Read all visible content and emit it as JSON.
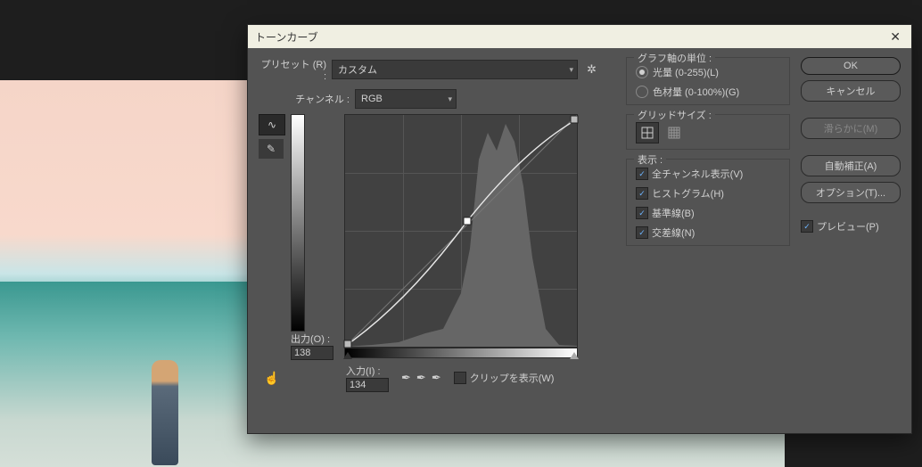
{
  "dialog_title": "トーンカーブ",
  "preset_label": "プリセット (R) :",
  "preset_value": "カスタム",
  "channel_label": "チャンネル :",
  "channel_value": "RGB",
  "output_label": "出力(O) :",
  "output_value": "138",
  "input_label": "入力(I) :",
  "input_value": "134",
  "clip_label": "クリップを表示(W)",
  "axis": {
    "group_title": "グラフ軸の単位 :",
    "light_label": "光量 (0-255)(L)",
    "pigment_label": "色材量 (0-100%)(G)",
    "light_selected": true
  },
  "grid_size": {
    "group_title": "グリッドサイズ :"
  },
  "display": {
    "group_title": "表示 :",
    "all_channels": "全チャンネル表示(V)",
    "histogram": "ヒストグラム(H)",
    "baseline": "基準線(B)",
    "intersection": "交差線(N)"
  },
  "buttons": {
    "ok": "OK",
    "cancel": "キャンセル",
    "smooth": "滑らかに(M)",
    "auto": "自動補正(A)",
    "options": "オプション(T)...",
    "preview": "プレビュー(P)"
  }
}
